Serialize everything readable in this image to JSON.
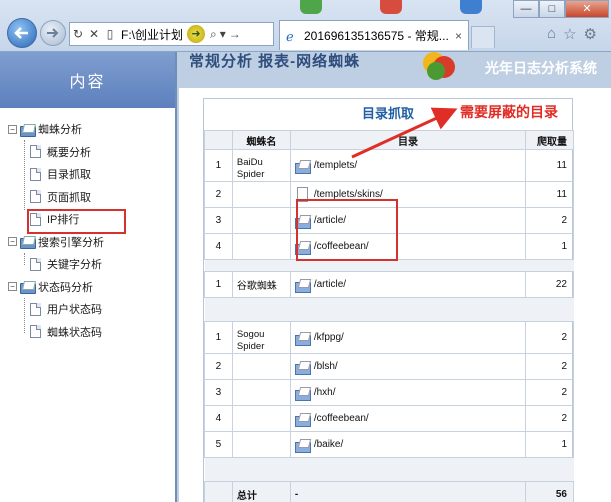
{
  "browser": {
    "address": "F:\\创业计划",
    "tab_title": "201696135136575 - 常规...",
    "tab_close": "×",
    "win_minimize": "—",
    "win_restore": "□",
    "win_close": "✕"
  },
  "sidebar": {
    "title": "内容",
    "groups": [
      {
        "label": "蜘蛛分析",
        "items": [
          "概要分析",
          "目录抓取",
          "页面抓取",
          "IP排行"
        ]
      },
      {
        "label": "搜索引擎分析",
        "items": [
          "关键字分析"
        ]
      },
      {
        "label": "状态码分析",
        "items": [
          "用户状态码",
          "蜘蛛状态码"
        ]
      }
    ]
  },
  "banner": {
    "left_text": "常规分析 报表-网络蜘蛛",
    "right_text": "光年日志分析系统"
  },
  "panel": {
    "title": "目录抓取",
    "headers": [
      "",
      "蜘蛛名",
      "目录",
      "爬取量"
    ],
    "groups": [
      {
        "spider": "BaiDu Spider",
        "rows": [
          {
            "n": "1",
            "dir": "/templets/",
            "count": "11"
          },
          {
            "n": "2",
            "dir": "/templets/skins/",
            "count": "11"
          },
          {
            "n": "3",
            "dir": "/article/",
            "count": "2"
          },
          {
            "n": "4",
            "dir": "/coffeebean/",
            "count": "1"
          }
        ]
      },
      {
        "spider": "谷歌蜘蛛",
        "rows": [
          {
            "n": "1",
            "dir": "/article/",
            "count": "22"
          }
        ]
      },
      {
        "spider": "Sogou Spider",
        "rows": [
          {
            "n": "1",
            "dir": "/kfppg/",
            "count": "2"
          },
          {
            "n": "2",
            "dir": "/blsh/",
            "count": "2"
          },
          {
            "n": "3",
            "dir": "/hxh/",
            "count": "2"
          },
          {
            "n": "4",
            "dir": "/coffeebean/",
            "count": "2"
          },
          {
            "n": "5",
            "dir": "/baike/",
            "count": "1"
          }
        ]
      }
    ],
    "total": {
      "label": "总计",
      "dir": "-",
      "count": "56"
    }
  },
  "annotation": {
    "text": "需要屏蔽的目录",
    "color": "#e02d25"
  },
  "colors": {
    "highlight_box": "#d4322e",
    "sidebar_header": "#5d80bd",
    "link_blue": "#205ea5"
  }
}
